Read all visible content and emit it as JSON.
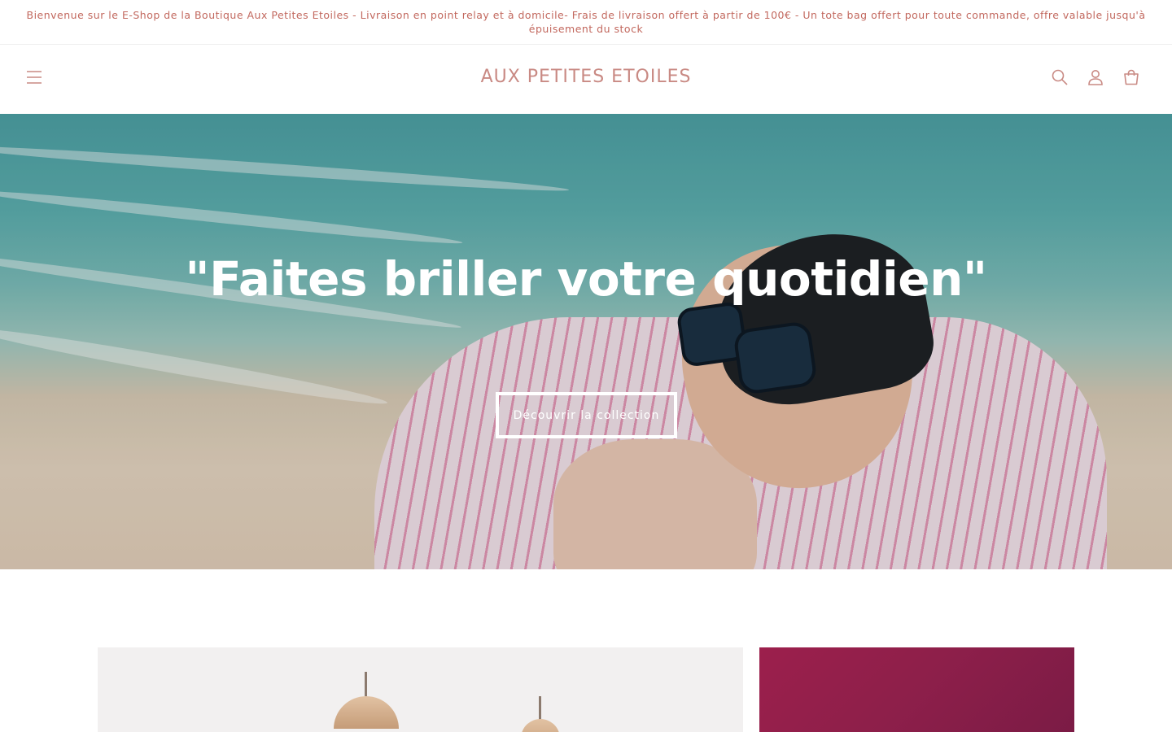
{
  "announcement": {
    "text": "Bienvenue sur le E-Shop de la Boutique Aux Petites Etoiles - Livraison en point relay et à domicile- Frais de livraison offert à partir de 100€ - Un tote bag offert pour toute commande, offre valable jusqu'à épuisement du stock"
  },
  "header": {
    "logo": "AUX PETITES ETOILES",
    "icons": {
      "menu": "hamburger-icon",
      "search": "search-icon",
      "account": "account-icon",
      "cart": "cart-icon"
    }
  },
  "hero": {
    "heading": "\"Faites briller votre quotidien\"",
    "cta_label": "Découvrir la collection"
  },
  "colors": {
    "accent": "#c2685e",
    "logo": "#c98a84",
    "hero_text": "#ffffff"
  }
}
